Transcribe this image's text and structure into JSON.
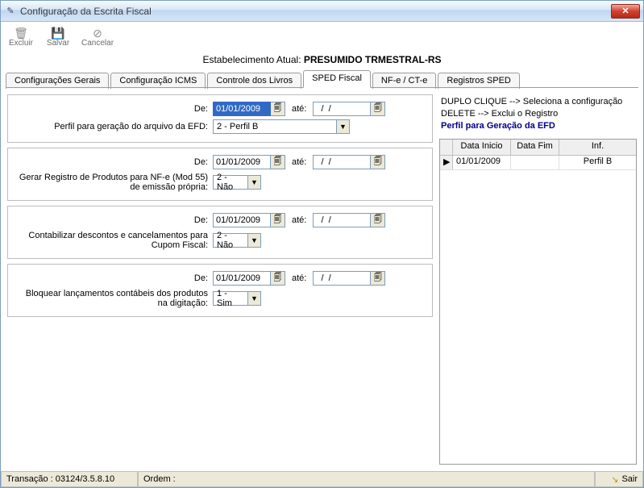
{
  "window": {
    "title": "Configuração da Escrita Fiscal"
  },
  "toolbar": {
    "excluir": "Excluir",
    "salvar": "Salvar",
    "cancelar": "Cancelar"
  },
  "header": {
    "label": "Estabelecimento Atual:",
    "value": "PRESUMIDO TRMESTRAL-RS"
  },
  "tabs": {
    "gerais": "Configurações Gerais",
    "icms": "Configuração ICMS",
    "livros": "Controle dos Livros",
    "sped": "SPED Fiscal",
    "nfe": "NF-e / CT-e",
    "regsped": "Registros SPED"
  },
  "labels": {
    "de": "De:",
    "ate": "até:"
  },
  "sections": [
    {
      "de": "01/01/2009",
      "ate": "  /  /    ",
      "label": "Perfil para geração do arquivo da EFD:",
      "combo": "2 - Perfil B",
      "combo_wide": true,
      "de_selected": true
    },
    {
      "de": "01/01/2009",
      "ate": "  /  /    ",
      "label": "Gerar Registro de Produtos para NF-e (Mod 55) de emissão própria:",
      "combo": "2 - Não",
      "combo_wide": false,
      "de_selected": false
    },
    {
      "de": "01/01/2009",
      "ate": "  /  /    ",
      "label": "Contabilizar descontos e cancelamentos para Cupom Fiscal:",
      "combo": "2 - Não",
      "combo_wide": false,
      "de_selected": false
    },
    {
      "de": "01/01/2009",
      "ate": "  /  /    ",
      "label": "Bloquear lançamentos contábeis dos produtos na digitação:",
      "combo": "1 - Sim",
      "combo_wide": false,
      "de_selected": false
    }
  ],
  "hints": {
    "line1a": "DUPLO CLIQUE --> Seleciona a configuração",
    "line2a": "DELETE --> Exclui o Registro",
    "line3": "Perfil para Geração da EFD"
  },
  "grid": {
    "headers": {
      "c1": "Data Inicio",
      "c2": "Data Fim",
      "c3": "Inf."
    },
    "rows": [
      {
        "c1": "01/01/2009",
        "c2": "",
        "c3": "Perfil B"
      }
    ]
  },
  "status": {
    "trans_label": "Transação :",
    "trans_value": "03124/3.5.8.10",
    "ordem_label": "Ordem :",
    "sair": "Sair"
  },
  "icons": {
    "calendar": "🗐",
    "close_x": "✕"
  }
}
